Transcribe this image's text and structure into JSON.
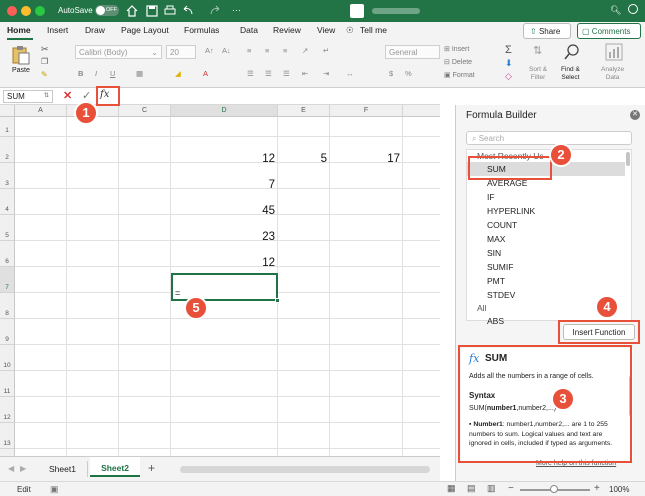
{
  "titlebar": {
    "autosave_label": "AutoSave",
    "autosave_state": "OFF"
  },
  "tabs": [
    "Home",
    "Insert",
    "Draw",
    "Page Layout",
    "Formulas",
    "Data",
    "Review",
    "View"
  ],
  "tell_me": "Tell me",
  "share_label": "Share",
  "comments_label": "Comments",
  "ribbon": {
    "paste": "Paste",
    "font_name": "Calibri (Body)",
    "font_size": "20",
    "number_format": "General",
    "insert": "Insert",
    "delete": "Delete",
    "format": "Format",
    "sort_filter": "Sort &\nFilter",
    "find_select": "Find &\nSelect",
    "analyze_data": "Analyze\nData"
  },
  "formula_bar": {
    "name_box": "SUM",
    "fx": "fx"
  },
  "columns": [
    "A",
    "B",
    "C",
    "D",
    "E",
    "F"
  ],
  "rows": [
    "1",
    "2",
    "3",
    "4",
    "5",
    "6",
    "7",
    "8",
    "9",
    "10",
    "11",
    "12",
    "13"
  ],
  "cells": {
    "d2": "12",
    "e2": "5",
    "f2": "17",
    "d3": "7",
    "d4": "45",
    "d5": "23",
    "d6": "12",
    "d7": "="
  },
  "sheets": {
    "sheet1": "Sheet1",
    "sheet2": "Sheet2",
    "add": "+"
  },
  "status": {
    "mode": "Edit",
    "zoom": "100%"
  },
  "formula_builder": {
    "title": "Formula Builder",
    "search_placeholder": "Search",
    "recent_heading": "Most Recently Us",
    "recent": [
      "SUM",
      "AVERAGE",
      "IF",
      "HYPERLINK",
      "COUNT",
      "MAX",
      "SIN",
      "SUMIF",
      "PMT",
      "STDEV"
    ],
    "all_heading": "All",
    "all": [
      "ABS"
    ],
    "insert_button": "Insert Function",
    "detail": {
      "icon": "fx",
      "name": "SUM",
      "desc": "Adds all the numbers in a range of cells.",
      "syntax_heading": "Syntax",
      "syntax_fn": "SUM(",
      "syntax_arg": "number1",
      "syntax_rest": ",number2,...)",
      "arg_name": "Number1",
      "arg_desc": ": number1,number2,... are 1 to 255 numbers to sum. Logical values and text are ignored in cells, included if typed as arguments.",
      "more_help": "More help on this function"
    }
  },
  "annotations": [
    "1",
    "2",
    "3",
    "4",
    "5"
  ],
  "colors": {
    "excel_green": "#227447",
    "annotation_red": "#e8503a",
    "selection_green": "#217346"
  }
}
